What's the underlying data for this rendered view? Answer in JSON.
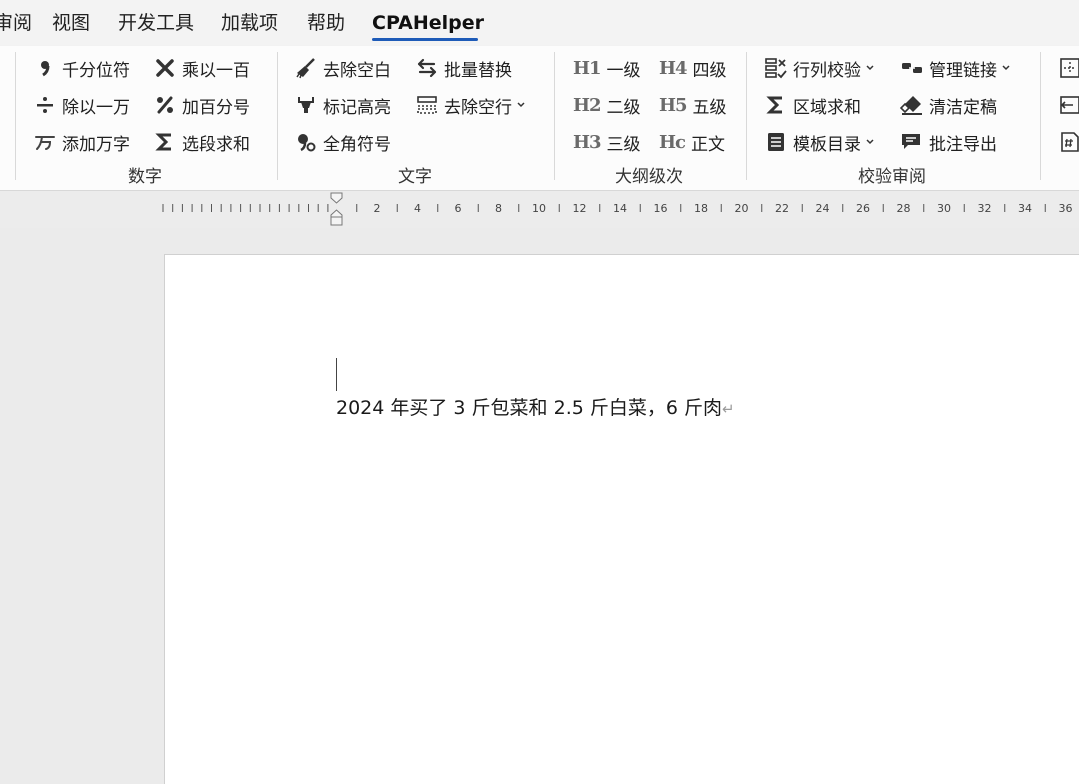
{
  "tabs": {
    "review_partial": "审阅",
    "view": "视图",
    "developer": "开发工具",
    "addins": "加载项",
    "help": "帮助",
    "cpahelper": "CPAHelper"
  },
  "ribbon": {
    "number": {
      "label": "数字",
      "thousand_sep": "千分位符",
      "multiply_100": "乘以一百",
      "divide_10k": "除以一万",
      "add_percent": "加百分号",
      "add_wan": "添加万字",
      "sum_selection": "选段求和"
    },
    "text": {
      "label": "文字",
      "remove_spaces": "去除空白",
      "batch_replace": "批量替换",
      "mark_highlight": "标记高亮",
      "remove_blank_lines": "去除空行",
      "full_width": "全角符号"
    },
    "outline": {
      "label": "大纲级次",
      "h1": "一级",
      "h2": "二级",
      "h3": "三级",
      "h4": "四级",
      "h5": "五级",
      "body": "正文",
      "icon_h1": "H1",
      "icon_h2": "H2",
      "icon_h3": "H3",
      "icon_h4": "H4",
      "icon_h5": "H5",
      "icon_body": "Hc"
    },
    "review": {
      "label": "校验审阅",
      "row_col_check": "行列校验",
      "region_sum": "区域求和",
      "template_toc": "模板目录",
      "manage_links": "管理链接",
      "clean_final": "清洁定稿",
      "export_comments": "批注导出"
    }
  },
  "ruler": {
    "numbers": [
      "2",
      "4",
      "6",
      "8",
      "10",
      "12",
      "14",
      "16",
      "18",
      "20",
      "22",
      "24",
      "26",
      "28",
      "30",
      "32",
      "34",
      "36"
    ]
  },
  "document": {
    "line1": "2024 年买了 3 斤包菜和 2.5 斤白菜，6 斤肉",
    "paragraph_mark": "↵"
  },
  "colors": {
    "accent": "#1e5bb8",
    "ribbon_bg": "#fcfcfc",
    "tabbar_bg": "#f3f3f3",
    "canvas_bg": "#ebebeb",
    "icon": "#444444"
  }
}
